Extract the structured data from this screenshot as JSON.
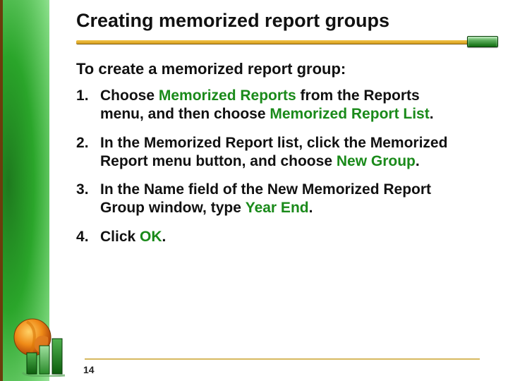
{
  "title": "Creating memorized report groups",
  "intro": "To create a memorized report group:",
  "steps": [
    {
      "pre": "Choose ",
      "kw1": "Memorized Reports",
      "mid": " from the Reports menu, and then choose ",
      "kw2": "Memorized Report List",
      "post": "."
    },
    {
      "pre": "In the Memorized Report list, click the Memorized Report menu button, and choose ",
      "kw1": "New Group",
      "mid": "",
      "kw2": "",
      "post": "."
    },
    {
      "pre": "In the Name field of the New Memorized Report Group window, type ",
      "kw1": "Year End",
      "mid": "",
      "kw2": "",
      "post": "."
    },
    {
      "pre": "Click ",
      "kw1": "OK",
      "mid": "",
      "kw2": "",
      "post": "."
    }
  ],
  "page_number": "14"
}
